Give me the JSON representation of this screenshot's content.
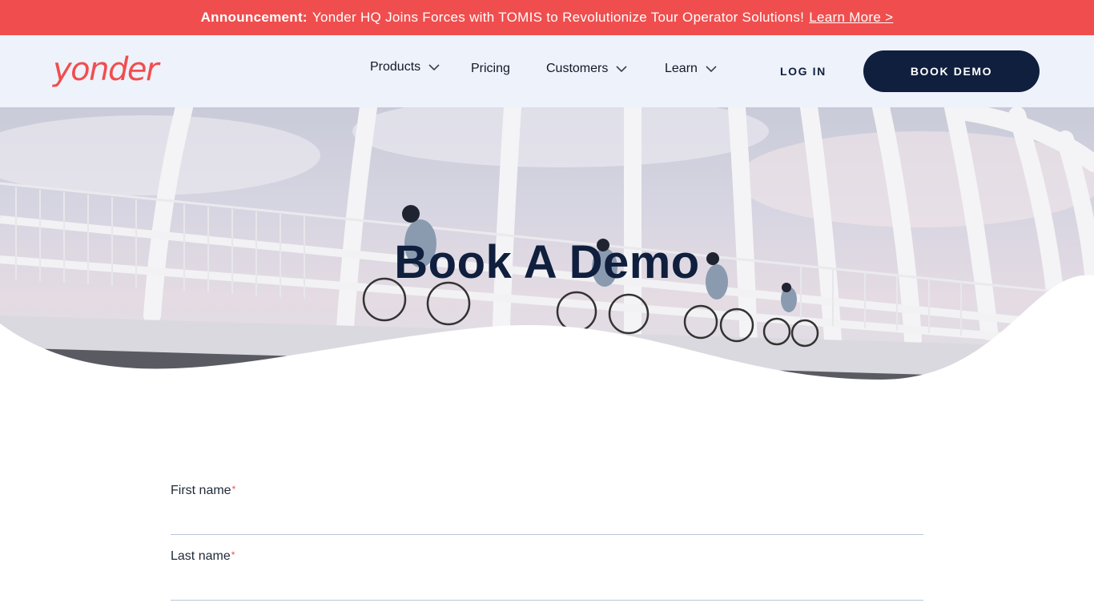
{
  "announcement": {
    "label": "Announcement:",
    "text": "Yonder HQ Joins Forces with TOMIS to Revolutionize Tour Operator Solutions!",
    "link": "Learn More >"
  },
  "nav": {
    "logo": "yonder",
    "items": [
      {
        "label": "Products",
        "dropdown": true
      },
      {
        "label": "Pricing",
        "dropdown": false
      },
      {
        "label": "Customers",
        "dropdown": true
      },
      {
        "label": "Learn",
        "dropdown": true
      }
    ],
    "login": "LOG IN",
    "cta": "BOOK DEMO"
  },
  "hero": {
    "title": "Book A Demo"
  },
  "form": {
    "fields": [
      {
        "label": "First name",
        "required": "*",
        "value": ""
      },
      {
        "label": "Last name",
        "required": "*",
        "value": ""
      }
    ]
  },
  "colors": {
    "brand": "#f04e4e",
    "navy": "#0f1f3d",
    "nav_bg": "#eef2fa"
  }
}
